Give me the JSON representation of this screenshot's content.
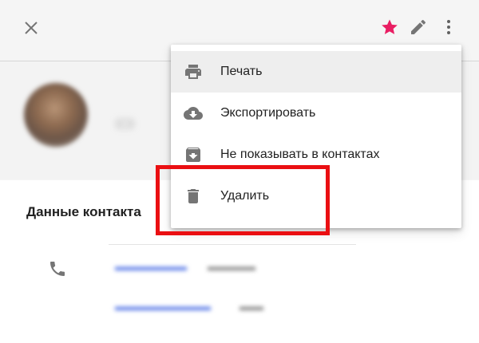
{
  "colors": {
    "accent_star": "#e91e63",
    "highlight_frame": "#ea0f12",
    "icon_grey": "#757575"
  },
  "toolbar": {
    "close_icon": "close-icon",
    "star_icon": "star-icon",
    "edit_icon": "pencil-icon",
    "more_icon": "more-vert-icon"
  },
  "menu": {
    "items": [
      {
        "label": "Печать",
        "icon": "printer-icon"
      },
      {
        "label": "Экспортировать",
        "icon": "cloud-download-icon"
      },
      {
        "label": "Не показывать в контактах",
        "icon": "archive-icon"
      },
      {
        "label": "Удалить",
        "icon": "trash-icon"
      }
    ]
  },
  "contact": {
    "details_title": "Данные контакта",
    "phone_icon": "phone-icon"
  }
}
